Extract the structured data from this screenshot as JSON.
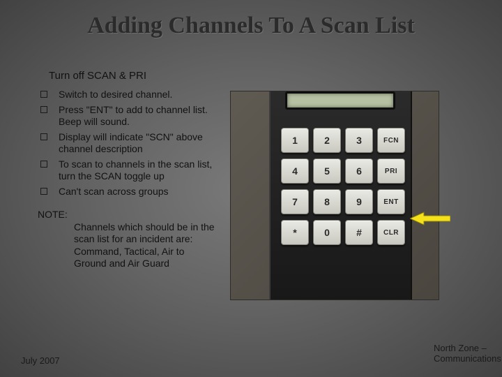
{
  "title": "Adding Channels To A Scan List",
  "intro": "Turn off SCAN & PRI",
  "bullets": [
    "Switch to desired channel.",
    "Press \"ENT\" to add to channel list. Beep will sound.",
    "Display will indicate \"SCN\" above channel description",
    "To scan to channels in the scan list, turn the SCAN toggle up",
    "Can't scan across groups"
  ],
  "note_label": "NOTE:",
  "note_body": "Channels which should be in the scan list for an incident are: Command, Tactical, Air to Ground and Air Guard",
  "footer_left": "July 2007",
  "footer_right": "North Zone – Communications",
  "keys": {
    "k1": "1",
    "k2": "2",
    "k3": "3",
    "kf1": "FCN",
    "k4": "4",
    "k5": "5",
    "k6": "6",
    "kf2": "PRI",
    "k7": "7",
    "k8": "8",
    "k9": "9",
    "kf3": "ENT",
    "ks": "*",
    "k0": "0",
    "kh": "#",
    "kf4": "CLR"
  }
}
